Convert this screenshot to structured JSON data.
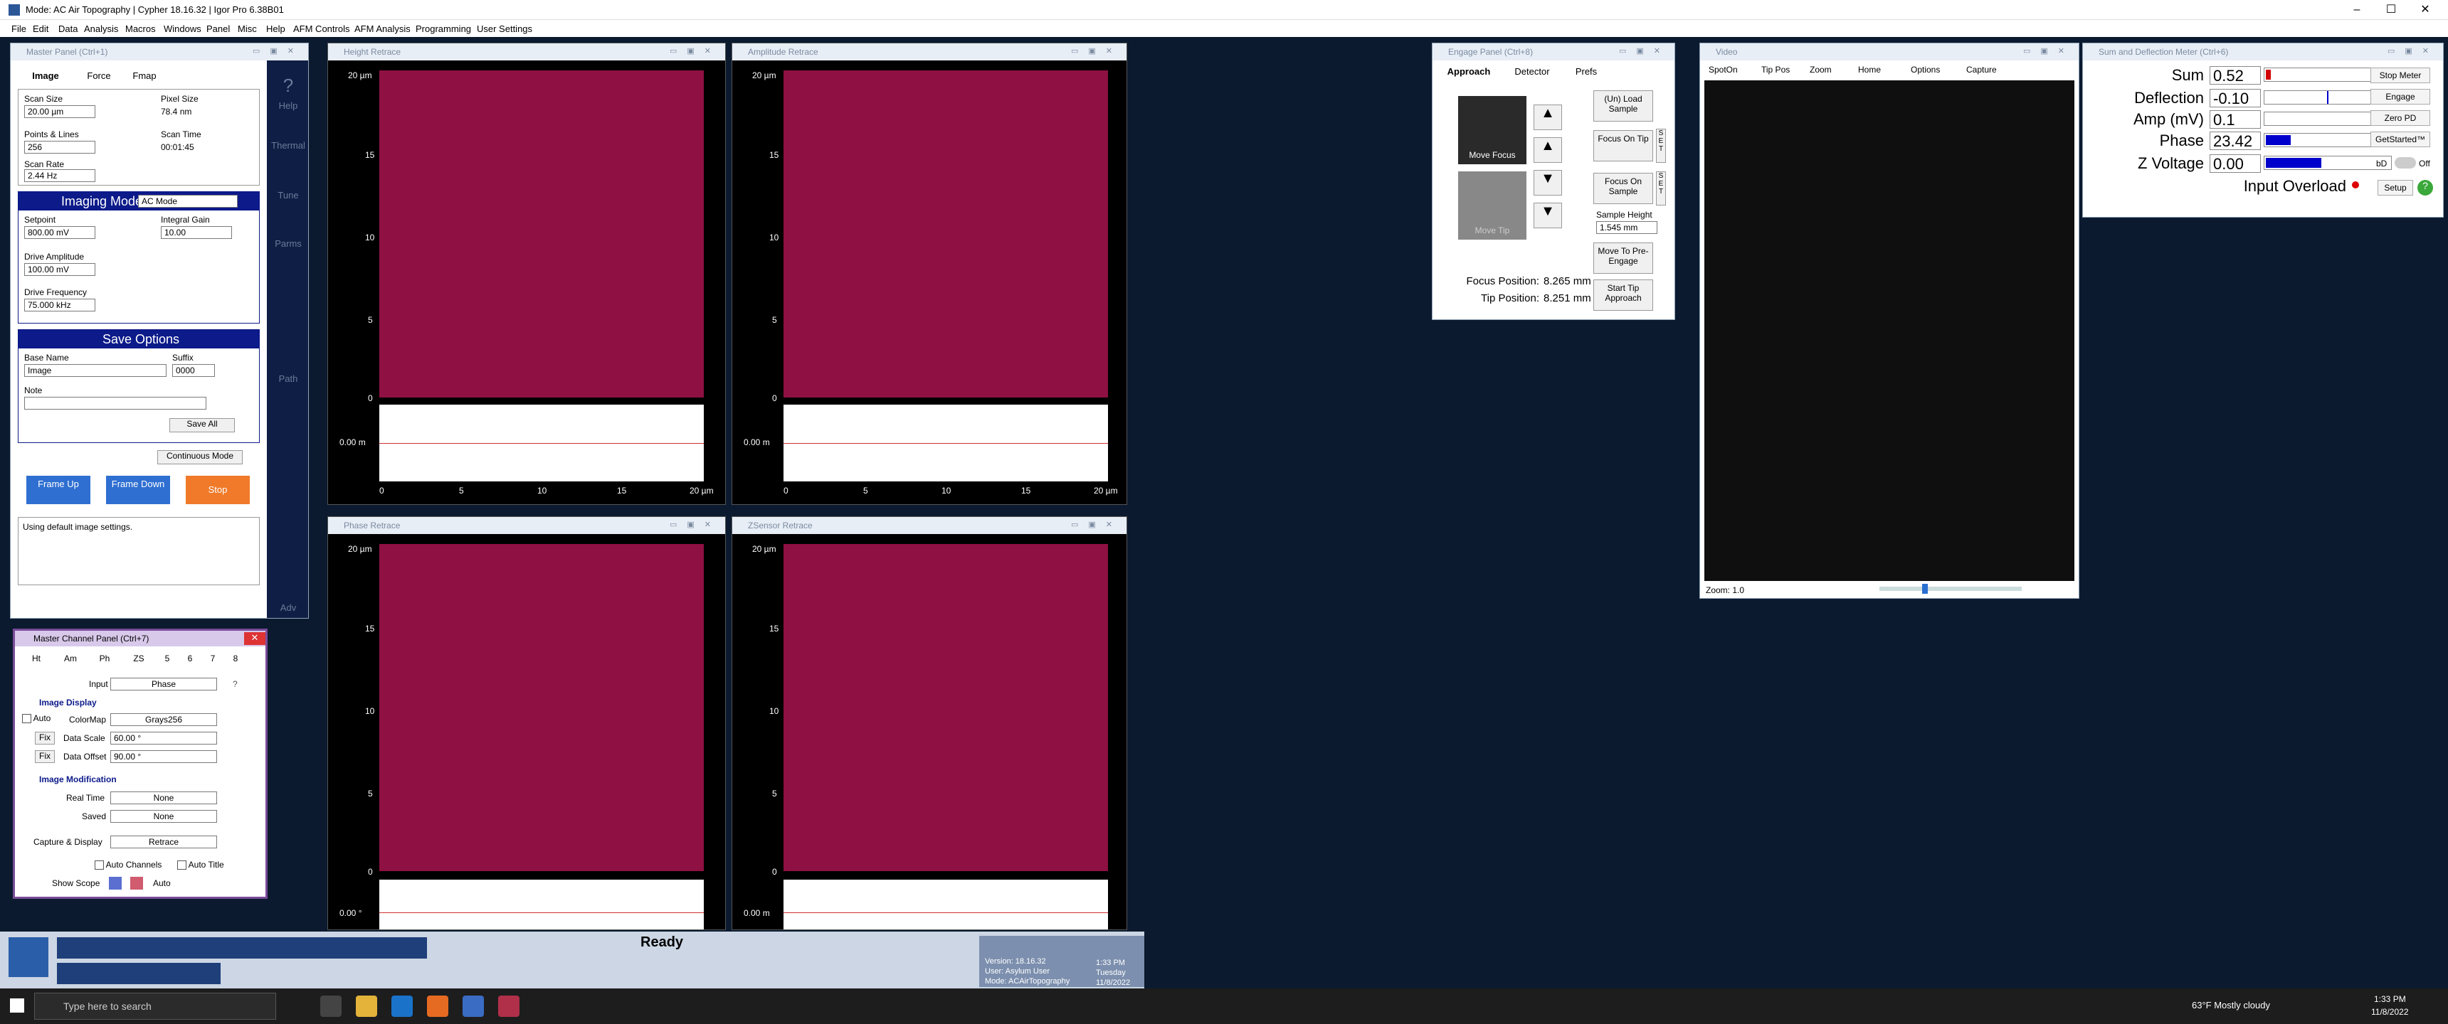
{
  "window": {
    "title": "Mode: AC Air Topography | Cypher 18.16.32 | Igor Pro 6.38B01",
    "controls": [
      "–",
      "☐",
      "✕"
    ]
  },
  "menu": [
    "File",
    "Edit",
    "Data",
    "Analysis",
    "Macros",
    "Windows",
    "Panel",
    "Misc",
    "Help",
    "AFM Controls",
    "AFM Analysis",
    "Programming",
    "User Settings"
  ],
  "master_panel": {
    "title": "Master Panel (Ctrl+1)",
    "tabs": [
      "Image",
      "Force",
      "Fmap"
    ],
    "scan_size_label": "Scan Size",
    "scan_size": "20.00 µm",
    "pixel_size_label": "Pixel Size",
    "pixel_size": "78.4 nm",
    "points_lines_label": "Points & Lines",
    "points_lines": "256",
    "scan_time_label": "Scan Time",
    "scan_time": "00:01:45",
    "scan_rate_label": "Scan Rate",
    "scan_rate": "2.44 Hz",
    "imaging_mode_label": "Imaging Mode",
    "imaging_mode": "AC Mode",
    "setpoint_label": "Setpoint",
    "setpoint": "800.00 mV",
    "integral_gain_label": "Integral Gain",
    "integral_gain": "10.00",
    "drive_amplitude_label": "Drive Amplitude",
    "drive_amplitude": "100.00 mV",
    "drive_frequency_label": "Drive Frequency",
    "drive_frequency": "75.000 kHz",
    "save_options_label": "Save Options",
    "base_name_label": "Base Name",
    "base_name": "Image",
    "suffix_label": "Suffix",
    "suffix": "0000",
    "note_label": "Note",
    "save_all": "Save All",
    "continuous_mode": "Continuous Mode",
    "frame_up": "Frame Up",
    "frame_down": "Frame Down",
    "stop": "Stop",
    "status": "Using default image settings.",
    "side_icons": [
      "Help",
      "Thermal",
      "Tune",
      "Parms",
      "Path",
      "Adv"
    ]
  },
  "channel_panel": {
    "title": "Master Channel Panel (Ctrl+7)",
    "tabs": [
      "Ht",
      "Am",
      "Ph",
      "ZS",
      "5",
      "6",
      "7",
      "8"
    ],
    "input_label": "Input",
    "input": "Phase",
    "image_display": "Image Display",
    "auto_label": "Auto",
    "colormap_label": "ColorMap",
    "colormap": "Grays256",
    "fix": "Fix",
    "data_scale_label": "Data Scale",
    "data_scale": "60.00 °",
    "data_offset_label": "Data Offset",
    "data_offset": "90.00 °",
    "image_modification": "Image Modification",
    "real_time_label": "Real Time",
    "real_time": "None",
    "saved_label": "Saved",
    "saved": "None",
    "capture_label": "Capture & Display",
    "capture": "Retrace",
    "auto_channels": "Auto Channels",
    "auto_title": "Auto Title",
    "show_scope": "Show Scope",
    "auto2": "Auto",
    "help": "?"
  },
  "graphs": [
    {
      "title": "Height Retrace",
      "y_ticks": [
        "20 µm",
        "15",
        "10",
        "5",
        "0"
      ],
      "x_ticks": [
        "0",
        "5",
        "10",
        "15",
        "20 µm"
      ],
      "scope": "0.00 m"
    },
    {
      "title": "Amplitude Retrace",
      "y_ticks": [
        "20 µm",
        "15",
        "10",
        "5",
        "0"
      ],
      "x_ticks": [
        "0",
        "5",
        "10",
        "15",
        "20 µm"
      ],
      "scope": "0.00 m"
    },
    {
      "title": "Phase Retrace",
      "y_ticks": [
        "20 µm",
        "15",
        "10",
        "5",
        "0"
      ],
      "scope": "0.00 °"
    },
    {
      "title": "ZSensor Retrace",
      "y_ticks": [
        "20 µm",
        "15",
        "10",
        "5",
        "0"
      ],
      "scope": "0.00 m"
    }
  ],
  "engage_panel": {
    "title": "Engage Panel (Ctrl+8)",
    "tabs": [
      "Approach",
      "Detector",
      "Prefs"
    ],
    "move_focus": "Move Focus",
    "move_tip": "Move Tip",
    "load_sample": "(Un) Load Sample",
    "focus_on_tip": "Focus On Tip",
    "focus_on_sample": "Focus On Sample",
    "set": "S E T",
    "sample_height_label": "Sample Height",
    "sample_height": "1.545 mm",
    "move_pre_engage": "Move To Pre-Engage",
    "start_tip_approach": "Start Tip Approach",
    "focus_position_label": "Focus Position:",
    "focus_position": "8.265 mm",
    "tip_position_label": "Tip Position:",
    "tip_position": "8.251 mm"
  },
  "video_panel": {
    "title": "Video",
    "toolbar": [
      "SpotOn",
      "Tip Pos",
      "Zoom",
      "Home",
      "Options",
      "Capture"
    ],
    "zoom": "Zoom: 1.0"
  },
  "meter_panel": {
    "title": "Sum and Deflection Meter (Ctrl+6)",
    "rows": [
      {
        "label": "Sum",
        "value": "0.52",
        "fill": 0.04,
        "color": "#d00000"
      },
      {
        "label": "Deflection",
        "value": "-0.10",
        "fill": 0.0,
        "color": "#0000cc"
      },
      {
        "label": "Amp (mV)",
        "value": "0.1",
        "fill": 0.0,
        "color": "#0000cc"
      },
      {
        "label": "Phase",
        "value": "23.42",
        "fill": 0.2,
        "color": "#0000cc"
      },
      {
        "label": "Z Voltage",
        "value": "0.00",
        "fill": 0.45,
        "color": "#0000cc"
      }
    ],
    "input_overload": "Input Overload",
    "buttons": [
      "Stop Meter",
      "Engage",
      "Zero PD",
      "GetStarted™"
    ],
    "bd": "bD",
    "off": "Off",
    "setup": "Setup"
  },
  "status_bar": {
    "ready": "Ready",
    "version": "Version: 18.16.32",
    "user": "User: Asylum User",
    "mode": "Mode: ACAirTopography",
    "time": "1:33 PM",
    "day": "Tuesday",
    "date": "11/8/2022"
  },
  "taskbar": {
    "search_placeholder": "Type here to search",
    "weather": "63°F  Mostly cloudy",
    "time": "1:33 PM",
    "date": "11/8/2022"
  }
}
